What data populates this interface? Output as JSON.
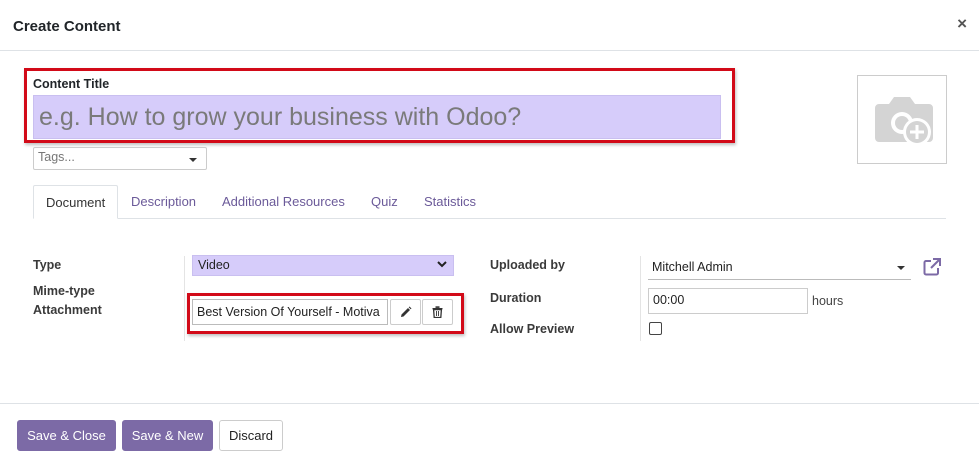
{
  "modal": {
    "title": "Create Content",
    "close_symbol": "×"
  },
  "form": {
    "title_label": "Content Title",
    "title_placeholder": "e.g. How to grow your business with Odoo?",
    "tags_placeholder": "Tags...",
    "image_icon": "camera-plus-icon"
  },
  "tabs": [
    {
      "label": "Document",
      "active": true
    },
    {
      "label": "Description",
      "active": false
    },
    {
      "label": "Additional Resources",
      "active": false
    },
    {
      "label": "Quiz",
      "active": false
    },
    {
      "label": "Statistics",
      "active": false
    }
  ],
  "document": {
    "type_label": "Type",
    "type_value": "Video",
    "mimetype_label": "Mime-type",
    "attachment_label": "Attachment",
    "attachment_value": "Best Version Of Yourself - Motiva",
    "uploaded_by_label": "Uploaded by",
    "uploaded_by_value": "Mitchell Admin",
    "duration_label": "Duration",
    "duration_value": "00:00",
    "duration_unit": "hours",
    "allow_preview_label": "Allow Preview",
    "allow_preview_checked": false
  },
  "footer": {
    "save_close": "Save & Close",
    "save_new": "Save & New",
    "discard": "Discard"
  },
  "colors": {
    "accent": "#7c6aa6",
    "required_field": "#d6ccfa",
    "highlight_box": "#d20a18"
  }
}
